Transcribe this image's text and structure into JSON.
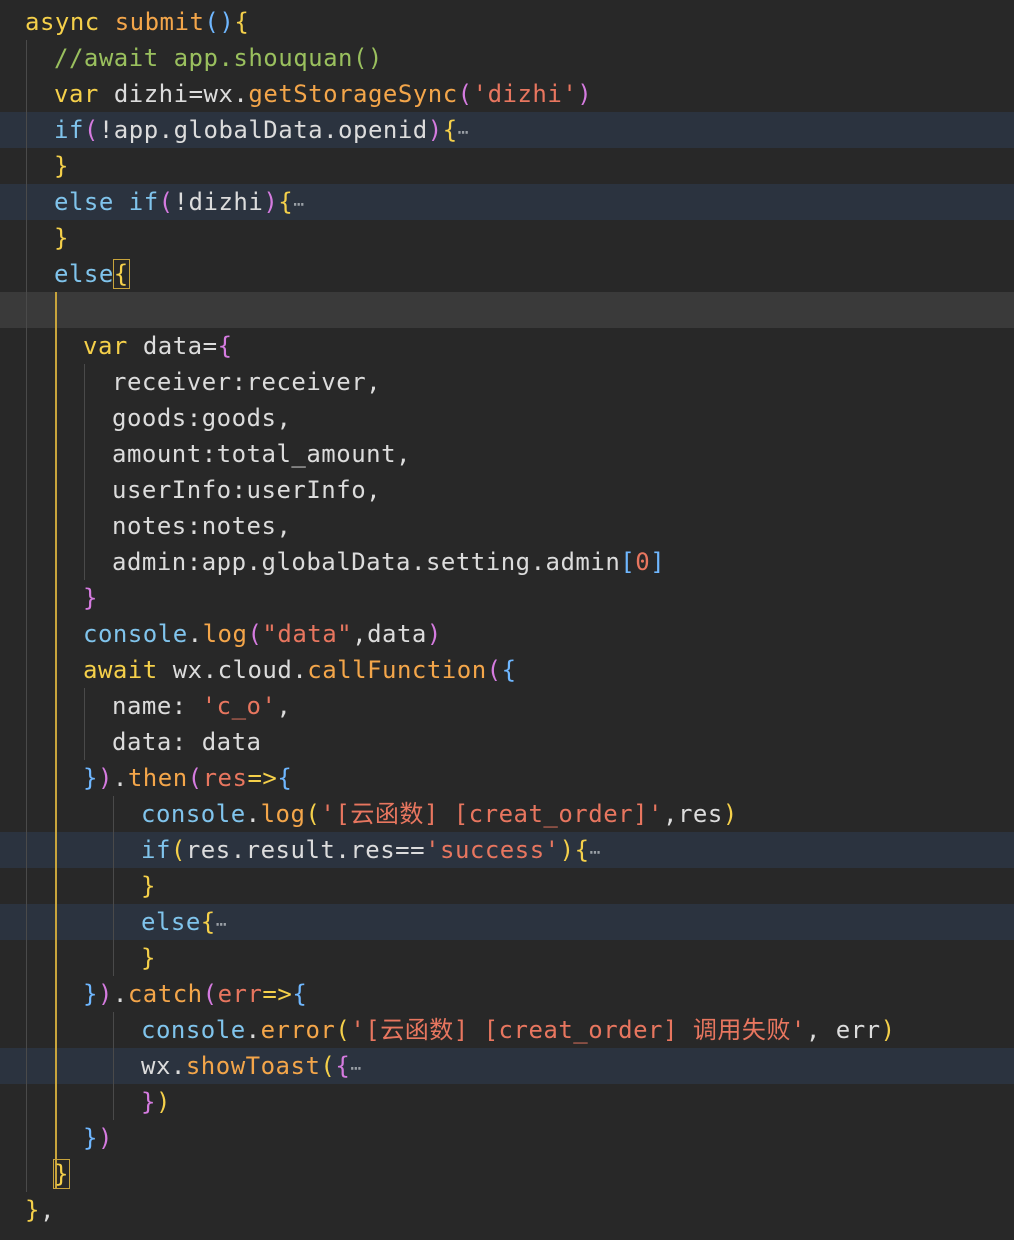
{
  "editor": {
    "collapsed_marker": "⋯",
    "tokens": {
      "async": "async",
      "submit": "submit",
      "comment": "//await app.shouquan()",
      "var": "var",
      "dizhi": "dizhi",
      "eq": "=",
      "wx": "wx",
      "dot": ".",
      "getStorageSync": "getStorageSync",
      "dizhi_str": "'dizhi'",
      "if": "if",
      "not_app_globalData_openid": "!app.globalData.openid",
      "else": "else",
      "else_if": "else if",
      "not_dizhi": "!dizhi",
      "data": "data",
      "receiver_key": "receiver",
      "receiver_val": "receiver",
      "goods_key": "goods",
      "goods_val": "goods",
      "amount_key": "amount",
      "amount_val": "total_amount",
      "userInfo_key": "userInfo",
      "userInfo_val": "userInfo",
      "notes_key": "notes",
      "notes_val": "notes",
      "admin_key": "admin",
      "admin_val": "app.globalData.setting.admin",
      "zero": "0",
      "console": "console",
      "log": "log",
      "data_str": "\"data\"",
      "await": "await",
      "cloud": "cloud",
      "callFunction": "callFunction",
      "name_key": "name",
      "c_o_str": "'c_o'",
      "then": "then",
      "res": "res",
      "arrow": "=>",
      "log_str_1": "'[云函数] [creat_order]'",
      "res_result_res": "res.result.res",
      "eqeq": "==",
      "success_str": "'success'",
      "catch": "catch",
      "err": "err",
      "error": "error",
      "error_str": "'[云函数] [creat_order] 调用失败'",
      "showToast": "showToast"
    }
  }
}
